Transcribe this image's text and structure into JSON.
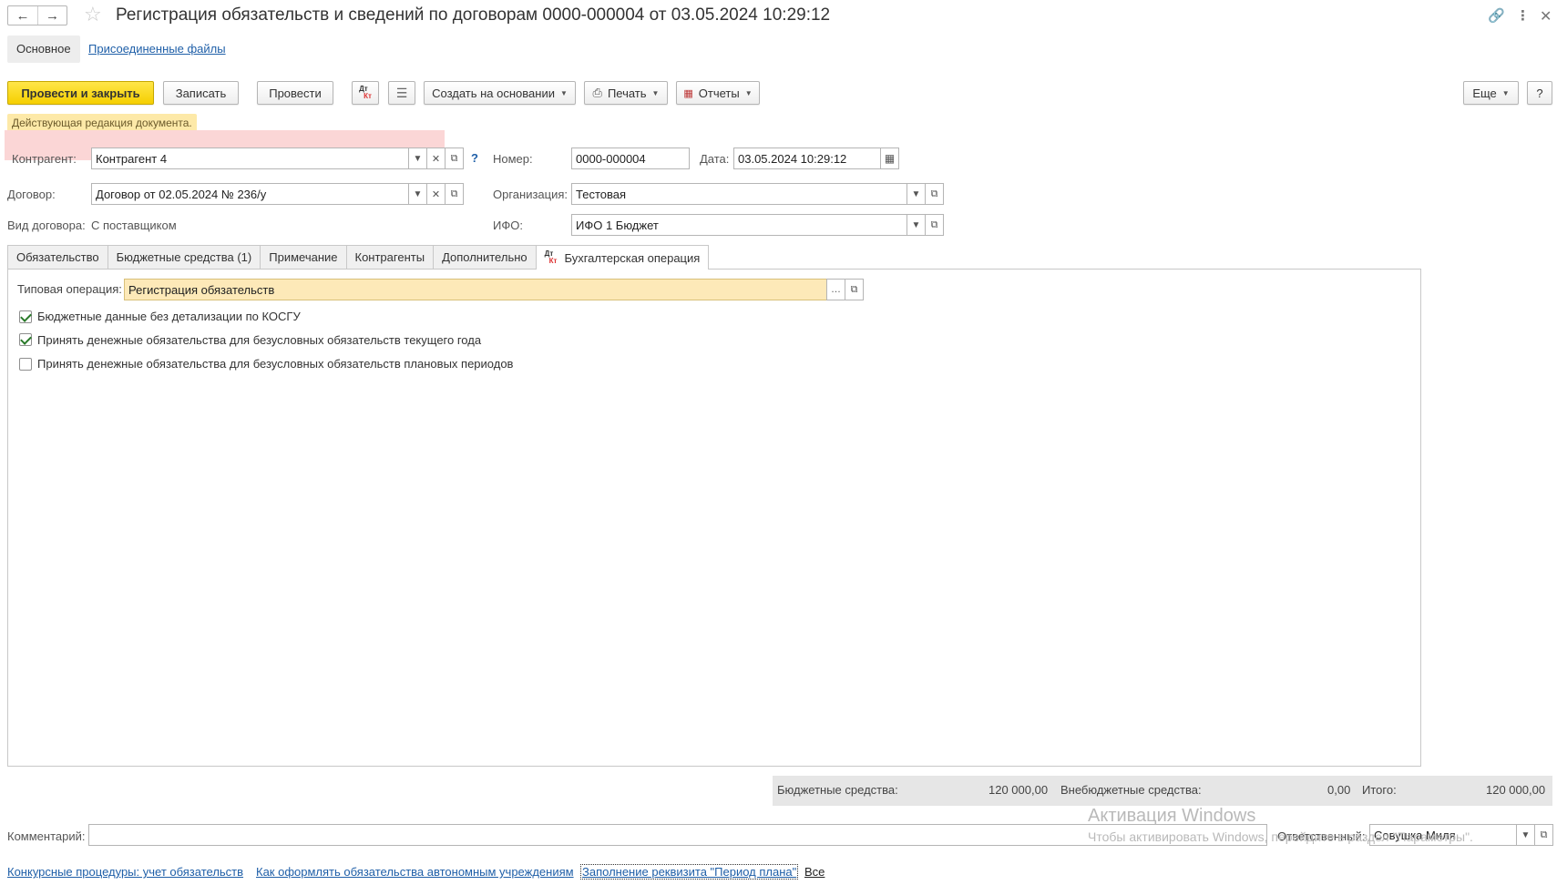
{
  "window": {
    "title": "Регистрация обязательств и сведений по договорам 0000-000004 от 03.05.2024 10:29:12"
  },
  "sections": {
    "main": "Основное",
    "files": "Присоединенные файлы"
  },
  "toolbar": {
    "post_close": "Провести и закрыть",
    "save": "Записать",
    "post": "Провести",
    "dt": "Дт",
    "kt": "Кт",
    "create_based": "Создать на основании",
    "print": "Печать",
    "reports": "Отчеты",
    "more": "Еще",
    "help": "?"
  },
  "notice": "Действующая редакция документа.",
  "form": {
    "kontragent_label": "Контрагент:",
    "kontragent_value": "Контрагент 4",
    "number_label": "Номер:",
    "number_value": "0000-000004",
    "date_label": "Дата:",
    "date_value": "03.05.2024 10:29:12",
    "dogovor_label": "Договор:",
    "dogovor_value": "Договор от 02.05.2024 № 236/у",
    "org_label": "Организация:",
    "org_value": "Тестовая",
    "vid_label": "Вид договора:",
    "vid_value": "С поставщиком",
    "ifo_label": "ИФО:",
    "ifo_value": "ИФО 1 Бюджет",
    "question": "?"
  },
  "tabs": [
    {
      "label": "Обязательство"
    },
    {
      "label": "Бюджетные средства (1)"
    },
    {
      "label": "Примечание"
    },
    {
      "label": "Контрагенты"
    },
    {
      "label": "Дополнительно"
    },
    {
      "label": "Бухгалтерская операция"
    }
  ],
  "operation": {
    "label": "Типовая операция:",
    "value": "Регистрация обязательств",
    "checkboxes": [
      {
        "label": "Бюджетные данные без детализации по КОСГУ",
        "checked": true
      },
      {
        "label": "Принять денежные обязательства для безусловных обязательств текущего года",
        "checked": true
      },
      {
        "label": "Принять денежные обязательства для безусловных обязательств плановых периодов",
        "checked": false
      }
    ]
  },
  "totals": {
    "budget_label": "Бюджетные средства:",
    "budget_value": "120 000,00",
    "extra_label": "Внебюджетные средства:",
    "extra_value": "0,00",
    "total_label": "Итого:",
    "total_value": "120 000,00"
  },
  "bottom": {
    "comment_label": "Комментарий:",
    "comment_value": "",
    "responsible_label": "Ответственный:",
    "responsible_value": "Совушка Миля"
  },
  "links": [
    "Конкурсные процедуры: учет обязательств",
    "Как оформлять обязательства автономным учреждениям",
    "Заполнение реквизита \"Период плана\"",
    "Все"
  ],
  "watermark": {
    "line1": "Активация Windows",
    "line2": "Чтобы активировать Windows, перейдите в раздел \"Параметры\"."
  }
}
